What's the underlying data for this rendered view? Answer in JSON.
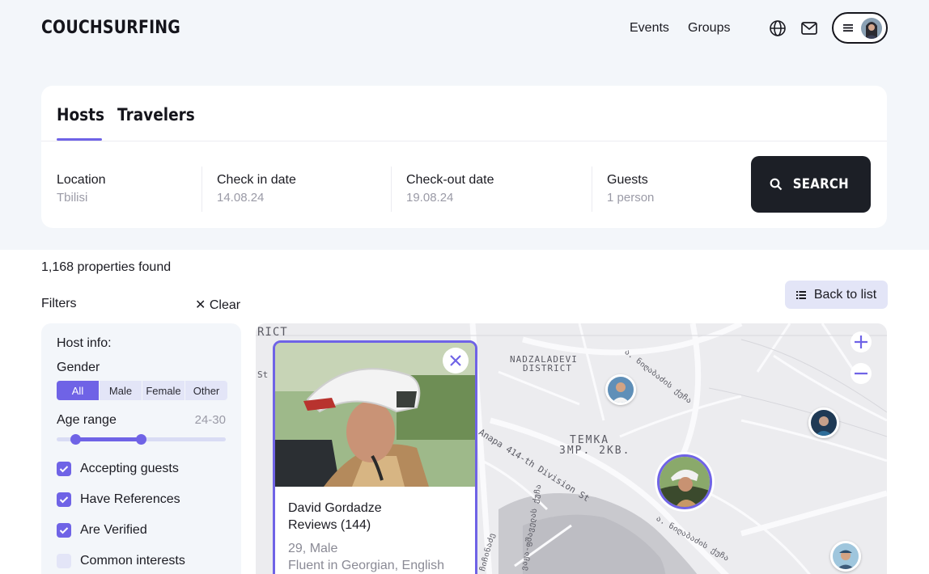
{
  "brand": {
    "logo": "COUCHSURFING"
  },
  "nav": {
    "events": "Events",
    "groups": "Groups"
  },
  "tabs": [
    {
      "label": "Hosts",
      "active": true
    },
    {
      "label": "Travelers",
      "active": false
    }
  ],
  "search": {
    "location": {
      "label": "Location",
      "value": "Tbilisi"
    },
    "checkin": {
      "label": "Check in date",
      "value": "14.08.24"
    },
    "checkout": {
      "label": "Check-out date",
      "value": "19.08.24"
    },
    "guests": {
      "label": "Guests",
      "value": "1 person"
    },
    "button": "SEARCH"
  },
  "results": {
    "count_text": "1,168 properties found",
    "back_button": "Back to list"
  },
  "filters": {
    "title": "Filters",
    "clear": "Clear",
    "host_info": "Host info:",
    "gender": {
      "label": "Gender",
      "options": [
        "All",
        "Male",
        "Female",
        "Other"
      ],
      "selected": "All"
    },
    "age_range": {
      "label": "Age range",
      "value": "24-30",
      "min": 24,
      "max": 30
    },
    "checks": [
      {
        "label": "Accepting guests",
        "checked": true
      },
      {
        "label": "Have References",
        "checked": true
      },
      {
        "label": "Are Verified",
        "checked": true
      },
      {
        "label": "Common interests",
        "checked": false
      }
    ]
  },
  "map": {
    "labels": {
      "rict": "RICT",
      "st": "St",
      "nadzaladevi_1": "NADZALADEVI",
      "nadzaladevi_2": "DISTRICT",
      "temka_1": "TEMKA",
      "temka_2": "3MP. 2KB.",
      "anapa": "Anapa 414-th Division St",
      "geo_1": "ა. ნიღაბაძის ქუჩა",
      "geo_2": "ა. ნიღაბაძის ქუჩა",
      "geo_3": "ვაჟა-ფშაველას ქუჩა",
      "geo_4": "ჩიჩინაძე"
    }
  },
  "profile": {
    "name": "David Gordadze",
    "reviews": "Reviews (144)",
    "age_gender": "29, Male",
    "languages": "Fluent in Georgian, English"
  },
  "colors": {
    "accent": "#6f63e6",
    "dark": "#1c1f26",
    "band": "#f3f6fa"
  }
}
